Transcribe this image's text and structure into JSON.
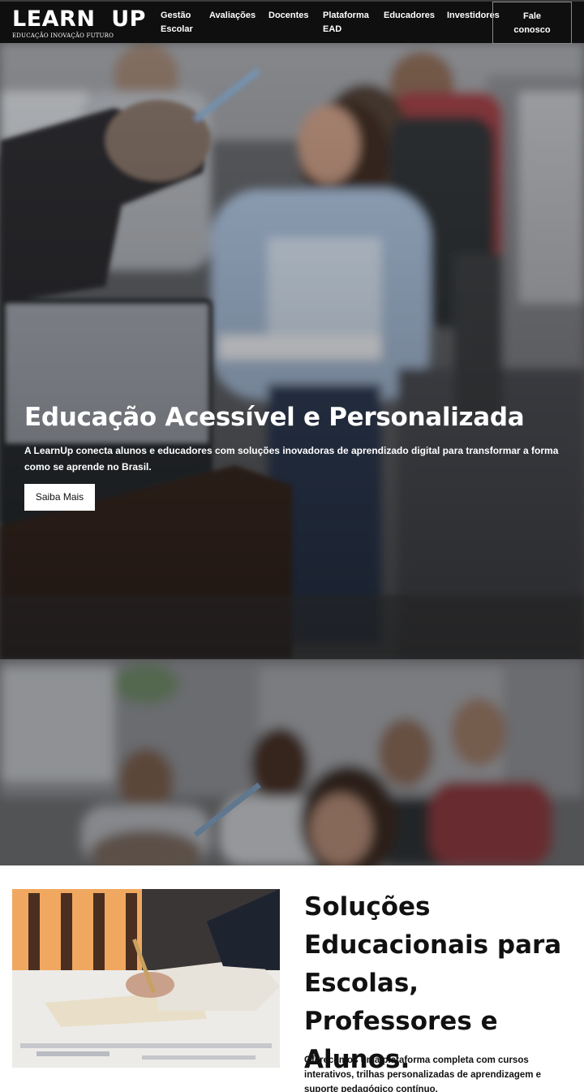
{
  "nav": {
    "logo": "LEARN  UP",
    "tagline": "EDUCAÇÃO INOVAÇÃO FUTURO",
    "items": [
      {
        "line1": "Gestão",
        "line2": "Escolar"
      },
      {
        "line1": "Avaliações",
        "line2": ""
      },
      {
        "line1": "Docentes",
        "line2": ""
      },
      {
        "line1": "Plataforma",
        "line2": "EAD"
      },
      {
        "line1": "Educadores",
        "line2": ""
      },
      {
        "line1": "Investidores",
        "line2": ""
      }
    ],
    "cta": {
      "line1": "Fale",
      "line2": "conosco"
    }
  },
  "hero": {
    "title": "Educação Acessível e Personalizada",
    "subtitle": "A LearnUp conecta alunos e educadores com soluções inovadoras de aprendizado digital para transformar a forma como se aprende no Brasil.",
    "button": "Saiba Mais"
  },
  "solutions": {
    "title": "Soluções Educacionais para Escolas, Professores e Alunos.",
    "text": "Oferecemos uma plataforma completa com cursos interativos, trilhas personalizadas de aprendizagem e suporte pedagógico contínuo."
  }
}
